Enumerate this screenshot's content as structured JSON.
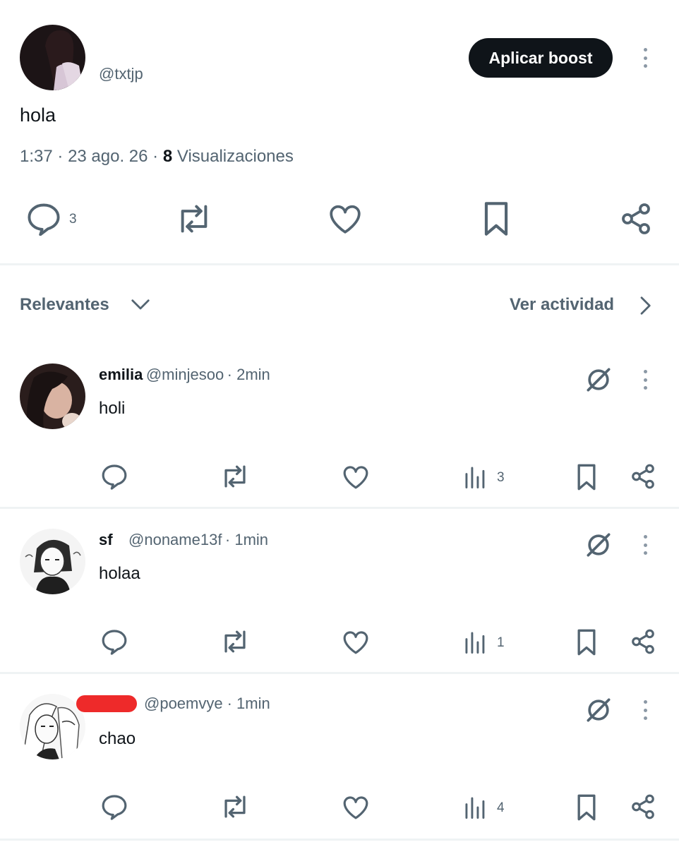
{
  "post": {
    "display_name": "",
    "handle": "@txtjp",
    "boost_label": "Aplicar boost",
    "text": "hola",
    "time": "1:37",
    "date": "23 ago. 26",
    "views_count": "8",
    "views_label": "Visualizaciones",
    "separator": "·",
    "reply_count": "3"
  },
  "sort": {
    "label": "Relevantes",
    "activity_label": "Ver actividad"
  },
  "replies": [
    {
      "name": "emilia",
      "handle": "@minjesoo",
      "time": "· 2min",
      "text": "holi",
      "views": "3"
    },
    {
      "name": "sf",
      "handle": "@noname13f",
      "time": "· 1min",
      "text": "holaa",
      "views": "1"
    },
    {
      "name": "",
      "handle": "@poemvye",
      "time": "· 1min",
      "text": "chao",
      "views": "4"
    }
  ],
  "colors": {
    "text": "#0f1419",
    "secondary": "#536471",
    "divider": "#eff3f4",
    "button": "#0f1419",
    "redaction": "#ee2a2a"
  }
}
